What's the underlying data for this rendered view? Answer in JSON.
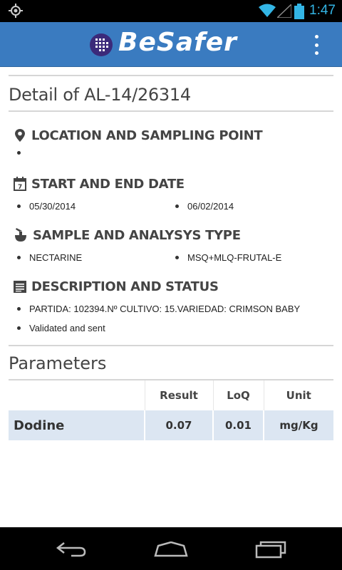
{
  "status_bar": {
    "time": "1:47",
    "icons": [
      "gps-icon",
      "wifi-icon",
      "signal-icon",
      "battery-icon"
    ]
  },
  "app_bar": {
    "title": "BeSafer",
    "menu_icon": "overflow-menu-icon"
  },
  "detail": {
    "title": "Detail of AL-14/26314"
  },
  "sections": {
    "location": {
      "heading": "LOCATION AND SAMPLING POINT",
      "icon": "map-marker-icon",
      "items": [
        ""
      ]
    },
    "dates": {
      "heading": "START AND END DATE",
      "icon": "calendar-icon",
      "start": "05/30/2014",
      "end": "06/02/2014"
    },
    "sample": {
      "heading": "SAMPLE AND ANALYSYS TYPE",
      "icon": "flask-icon",
      "sample_type": "NECTARINE",
      "analysis_type": "MSQ+MLQ-FRUTAL-E"
    },
    "description": {
      "heading": "DESCRIPTION AND STATUS",
      "icon": "list-icon",
      "description": "PARTIDA: 102394.Nº CULTIVO: 15.VARIEDAD: CRIMSON BABY",
      "status": "Validated and sent"
    }
  },
  "parameters": {
    "title": "Parameters",
    "columns": [
      "",
      "Result",
      "LoQ",
      "Unit"
    ],
    "rows": [
      {
        "name": "Dodine",
        "result": "0.07",
        "loq": "0.01",
        "unit": "mg/Kg"
      }
    ]
  },
  "colors": {
    "action_bar": "#3a7bc0",
    "row_highlight": "#dce6f2",
    "time_accent": "#33b5e5"
  },
  "nav_bar": {
    "icons": [
      "back-icon",
      "home-icon",
      "recents-icon"
    ]
  }
}
